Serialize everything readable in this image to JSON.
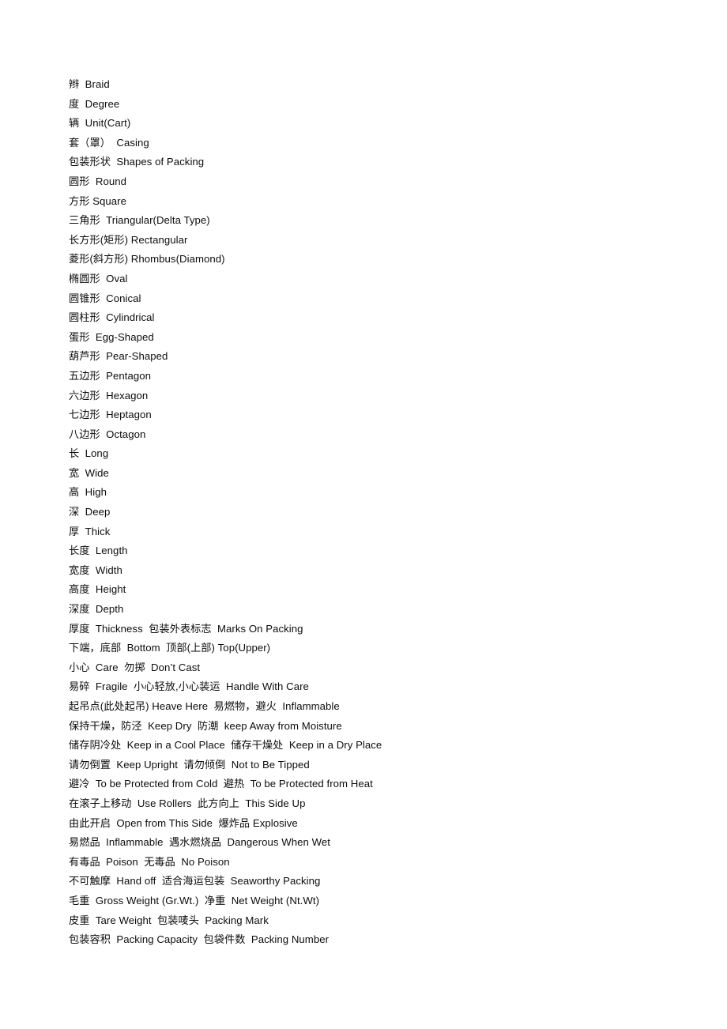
{
  "document": {
    "title": "Packing and Shipping Marks Glossary (Chinese-English)",
    "page_background": "#ffffff",
    "text_color": "#0d0d0d",
    "lines": [
      "辫  Braid",
      "度  Degree",
      "辆  Unit(Cart)",
      "套（罩）  Casing",
      "包装形状  Shapes of Packing",
      "圆形  Round",
      "方形 Square",
      "三角形  Triangular(Delta Type)",
      "长方形(矩形) Rectangular",
      "菱形(斜方形) Rhombus(Diamond)",
      "椭圆形  Oval",
      "圆锥形  Conical",
      "圆柱形  Cylindrical",
      "蛋形  Egg-Shaped",
      "葫芦形  Pear-Shaped",
      "五边形  Pentagon",
      "六边形  Hexagon",
      "七边形  Heptagon",
      "八边形  Octagon",
      "长  Long",
      "宽  Wide",
      "高  High",
      "深  Deep",
      "厚  Thick",
      "长度  Length",
      "宽度  Width",
      "高度  Height",
      "深度  Depth",
      "厚度  Thickness  包装外表标志  Marks On Packing",
      "下端，底部  Bottom  顶部(上部) Top(Upper)",
      "小心  Care  勿掷  Don’t Cast",
      "易碎  Fragile  小心轻放,小心装运  Handle With Care",
      "起吊点(此处起吊) Heave Here  易燃物，避火  Inflammable",
      "保持干燥，防泾  Keep Dry  防潮  keep Away from Moisture",
      "储存阴冷处  Keep in a Cool Place  储存干燥处  Keep in a Dry Place",
      "请勿倒置  Keep Upright  请勿倾倒  Not to Be Tipped",
      "避冷  To be Protected from Cold  避热  To be Protected from Heat",
      "在滚子上移动  Use Rollers  此方向上  This Side Up",
      "由此开启  Open from This Side  爆炸品 Explosive",
      "易燃品  Inflammable  遇水燃烧品  Dangerous When Wet",
      "有毒品  Poison  无毒品  No Poison",
      "不可触摩  Hand off  适合海运包装  Seaworthy Packing",
      "毛重  Gross Weight (Gr.Wt.)  净重  Net Weight (Nt.Wt)",
      "皮重  Tare Weight  包装唛头  Packing Mark",
      "包装容积  Packing Capacity  包袋件数  Packing Number"
    ]
  }
}
